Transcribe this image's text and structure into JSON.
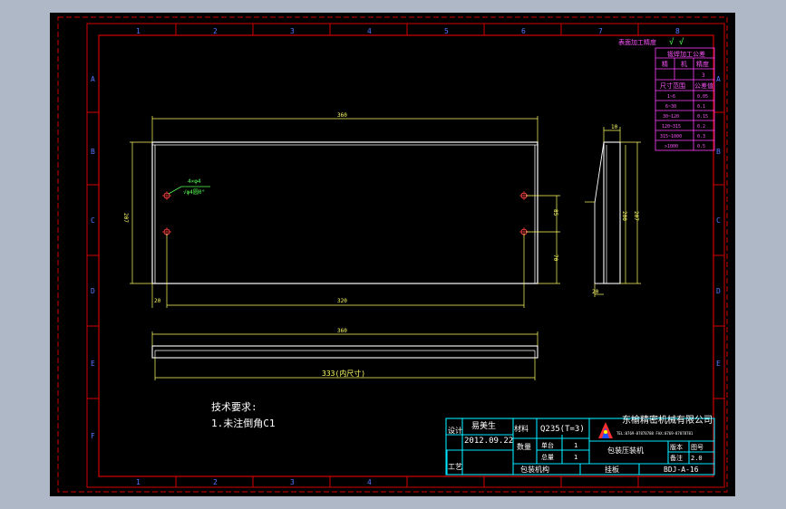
{
  "colors": {
    "background": "#aeb8c6",
    "paper": "#000000",
    "outer_border": "#d40000",
    "drawing_lines": "#ffffff",
    "dimension": "#ffff66",
    "title_block": "#00e5ff",
    "tolerance_table": "#ff40ff",
    "annotation": "#55ff55",
    "hole": "#ff4040"
  },
  "grid": {
    "columns": [
      "1",
      "2",
      "3",
      "4",
      "5",
      "6",
      "7",
      "8"
    ],
    "rows": [
      "A",
      "B",
      "C",
      "D",
      "E",
      "F"
    ]
  },
  "front_view": {
    "overall_width": "360",
    "height": "207",
    "hole_edge_offset": "20",
    "hole_spacing": "320",
    "hole_note_line1": "4×φ4",
    "hole_note_line2": "√φ4圆0°",
    "right_dim_1": "85",
    "right_dim_2": "70"
  },
  "side_view": {
    "top_dim": "10",
    "height_207": "207",
    "height_200": "200",
    "bottom_dim": "20"
  },
  "bottom_view": {
    "overall_width": "360",
    "bottom_dim": "333(内尺寸)"
  },
  "tolerance_table": {
    "header_title": "表面加工精度",
    "surface_symbols": "√  √",
    "title": "锻焊加工公差",
    "col_precision_1": "精",
    "col_precision_2": "机",
    "col_size": "精度",
    "row_header_label": "尺寸范围",
    "row_header_value": "公差值",
    "rows": [
      {
        "range": "1~6",
        "value": "0.05"
      },
      {
        "range": "6~30",
        "value": "0.1"
      },
      {
        "range": "30~120",
        "value": "0.15"
      },
      {
        "range": "120~315",
        "value": "0.2"
      },
      {
        "range": "315~1000",
        "value": "0.3"
      },
      {
        "range": ">1000",
        "value": "0.5"
      }
    ],
    "first_row_values": [
      "",
      "",
      "3"
    ]
  },
  "tech_requirements": {
    "title": "技术要求:",
    "item_1": "1.未注倒角C1"
  },
  "title_block": {
    "design_label": "设计",
    "designer": "易美生",
    "date": "2012.09.22",
    "process_label": "工艺",
    "material_label": "材料",
    "material": "Q235(T=3)",
    "quantity_label": "数量",
    "unit_label": "单台",
    "unit_value": "1",
    "total_label": "总量",
    "total_value": "1",
    "company": "东榆精密机械有限公司",
    "company_phone": "TEL:0769-87878788  FAX:0769-87878781",
    "part_name": "包装压装机",
    "version_label": "版本",
    "version_label_2": "备注",
    "drawing_no_label": "图号",
    "drawing_no_value": "2.0",
    "drawing_number": "BDJ-A-16",
    "assembly": "包装机构",
    "bottom_label": "挂板"
  }
}
